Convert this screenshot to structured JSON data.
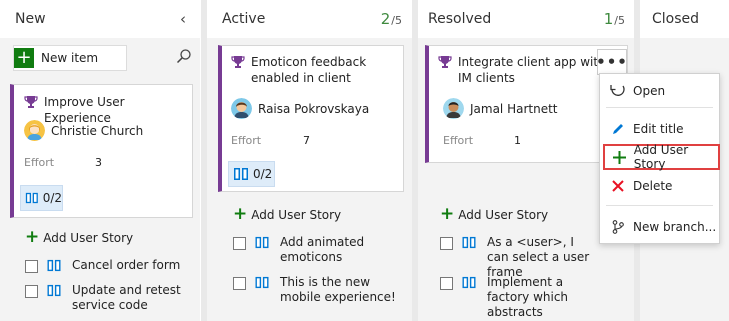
{
  "columns": [
    {
      "title": "New"
    },
    {
      "title": "Active",
      "count": "2",
      "limit": "/5"
    },
    {
      "title": "Resolved",
      "count": "1",
      "limit": "/5"
    },
    {
      "title": "Closed"
    }
  ],
  "toolbar": {
    "new_item_label": "New item"
  },
  "cards": [
    {
      "title": "Improve User Experience",
      "assignee": "Christie Church",
      "effort_label": "Effort",
      "effort": "3",
      "progress": "0/2",
      "add_story": "Add User Story",
      "tasks": [
        "Cancel order form",
        "Update and retest service code"
      ]
    },
    {
      "title": "Emoticon feedback enabled in client",
      "assignee": "Raisa Pokrovskaya",
      "effort_label": "Effort",
      "effort": "7",
      "progress": "0/2",
      "add_story": "Add User Story",
      "tasks": [
        "Add animated emoticons",
        "This is the new mobile experience!"
      ]
    },
    {
      "title": "Integrate client app with IM clients",
      "assignee": "Jamal Hartnett",
      "effort_label": "Effort",
      "effort": "1",
      "add_story": "Add User Story",
      "tasks": [
        "As a <user>, I can select a user frame",
        "Implement a factory which abstracts"
      ]
    }
  ],
  "context_menu": {
    "items": [
      "Open",
      "Edit title",
      "Add User Story",
      "Delete",
      "New branch..."
    ],
    "highlighted": "Add User Story"
  },
  "colors": {
    "accent_green": "#107c10",
    "card_stripe": "#773b93",
    "highlight": "#e04040",
    "delete_red": "#e81123",
    "edit_blue": "#0078d4"
  }
}
